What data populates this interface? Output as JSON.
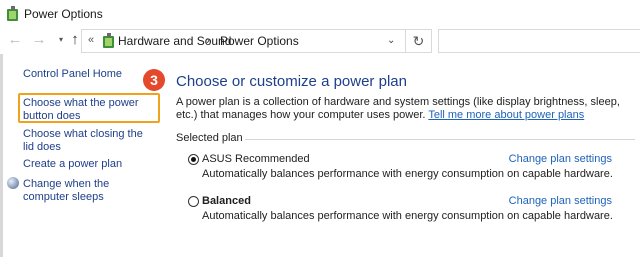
{
  "window": {
    "title": "Power Options",
    "app_icon": "power-options-icon"
  },
  "nav": {
    "back_icon": "arrow-left-icon",
    "forward_icon": "arrow-right-icon",
    "up_icon": "arrow-up-icon",
    "recent_icon": "chevron-down-icon"
  },
  "address": {
    "overflow": "«",
    "crumbs": [
      "Hardware and Sound",
      "Power Options"
    ],
    "separator": "›",
    "dropdown_icon": "chevron-down-icon",
    "refresh_icon": "refresh-icon",
    "refresh_glyph": "↻",
    "search_placeholder": ""
  },
  "sidebar": {
    "home": "Control Panel Home",
    "links": [
      "Choose what the power button does",
      "Choose what closing the lid does",
      "Create a power plan",
      "Change when the computer sleeps"
    ]
  },
  "annotation": {
    "step": "3",
    "accent": "#e3492a",
    "highlight_color": "#f0a21d"
  },
  "main": {
    "title": "Choose or customize a power plan",
    "description": "A power plan is a collection of hardware and system settings (like display brightness, sleep, etc.) that manages how your computer uses power.",
    "learn_more": "Tell me more about power plans",
    "section_label": "Selected plan",
    "plans": [
      {
        "name": "ASUS Recommended",
        "selected": true,
        "description": "Automatically balances performance with energy consumption on capable hardware.",
        "link": "Change plan settings"
      },
      {
        "name": "Balanced",
        "selected": false,
        "description": "Automatically balances performance with energy consumption on capable hardware.",
        "link": "Change plan settings"
      }
    ]
  }
}
